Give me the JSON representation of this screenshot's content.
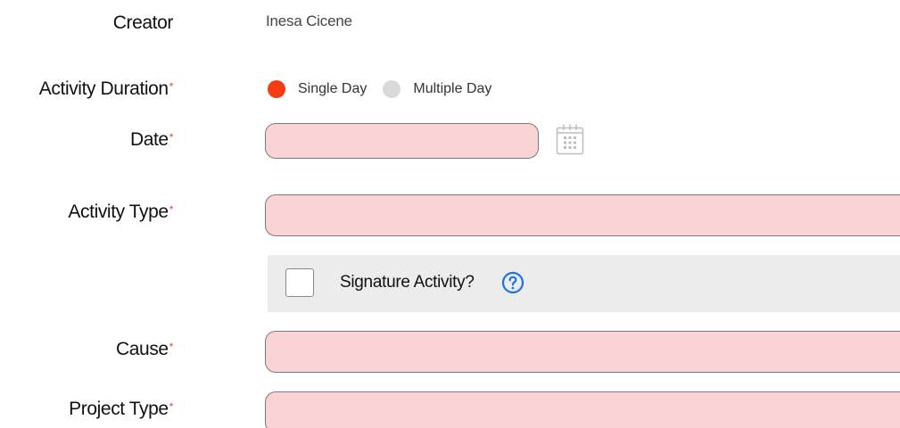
{
  "form": {
    "creator": {
      "label": "Creator",
      "value": "Inesa Cicene"
    },
    "activity_duration": {
      "label": "Activity Duration",
      "required_mark": "*",
      "options": [
        {
          "label": "Single Day",
          "selected": true
        },
        {
          "label": "Multiple Day",
          "selected": false
        }
      ]
    },
    "date": {
      "label": "Date",
      "required_mark": "*",
      "value": ""
    },
    "activity_type": {
      "label": "Activity Type",
      "required_mark": "*",
      "value": ""
    },
    "signature_activity": {
      "label": "Signature Activity?",
      "checked": false
    },
    "cause": {
      "label": "Cause",
      "required_mark": "*",
      "value": ""
    },
    "project_type": {
      "label": "Project Type",
      "required_mark": "*",
      "value": ""
    }
  },
  "colors": {
    "required": "#e8452c",
    "radio_selected": "#f23d12",
    "radio_unselected": "#d9d9d9",
    "invalid_field_bg": "#fad4d4",
    "help_icon": "#1a73e8",
    "signature_row_bg": "#ececec"
  },
  "icons": {
    "calendar": "calendar-icon",
    "help": "question-circle-icon",
    "dropdown": "chevron-down-icon"
  }
}
